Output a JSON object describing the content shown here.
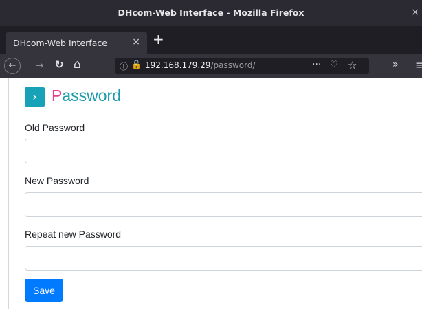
{
  "window": {
    "title": "DHcom-Web Interface - Mozilla Firefox",
    "close_icon": "×"
  },
  "tabs": [
    {
      "label": "DHcom-Web Interface",
      "close_icon": "×"
    }
  ],
  "new_tab_icon": "+",
  "nav": {
    "back_icon": "←",
    "forward_icon": "→",
    "reload_icon": "↻",
    "home_icon": "⌂",
    "url_host": "192.168.179.29",
    "url_path": "/password/",
    "page_actions_icon": "···",
    "pocket_icon": "♡",
    "bookmark_icon": "☆",
    "overflow_icon": "»",
    "menu_icon": "≡"
  },
  "page": {
    "header_icon": "›",
    "title_first": "P",
    "title_rest": "assword",
    "fields": [
      {
        "label": "Old Password",
        "value": ""
      },
      {
        "label": "New Password",
        "value": ""
      },
      {
        "label": "Repeat new Password",
        "value": ""
      }
    ],
    "save_label": "Save"
  },
  "colors": {
    "accent_teal": "#17a2b8",
    "title_pink": "#e83e8c",
    "primary_blue": "#007bff"
  }
}
